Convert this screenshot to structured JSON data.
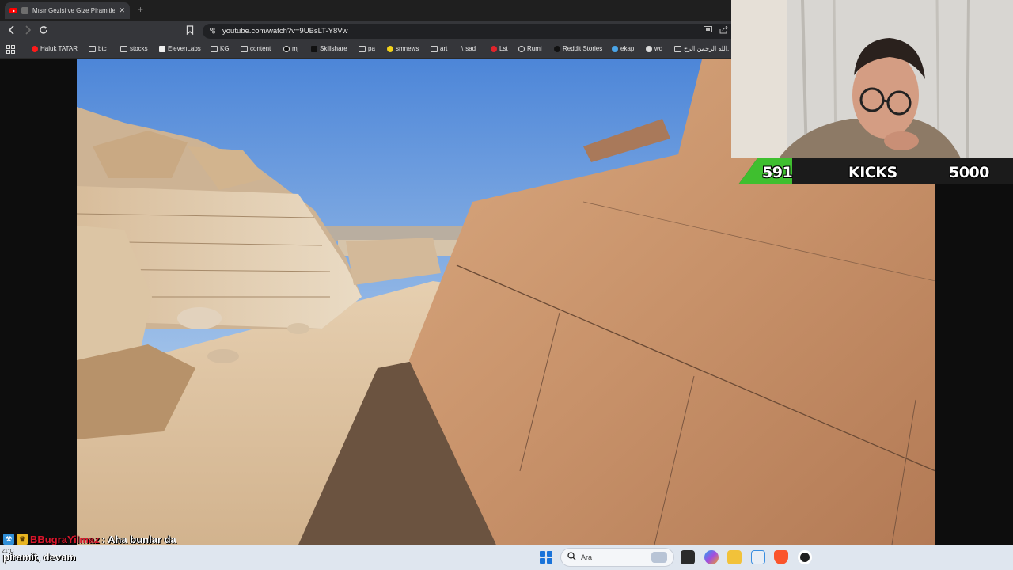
{
  "browser": {
    "tab_title": "Mısır Gezisi ve Gize Piramitler",
    "tab_close": "✕",
    "new_tab": "+",
    "url": "youtube.com/watch?v=9UBsLT-Y8Vw"
  },
  "bookmarks": [
    {
      "label": "Haluk TATAR",
      "icon": "youtube-icon"
    },
    {
      "label": "btc",
      "icon": "folder-icon"
    },
    {
      "label": "stocks",
      "icon": "folder-icon"
    },
    {
      "label": "ElevenLabs",
      "icon": "elevenlabs-icon"
    },
    {
      "label": "KG",
      "icon": "folder-icon"
    },
    {
      "label": "content",
      "icon": "folder-icon"
    },
    {
      "label": "mj",
      "icon": "github-icon"
    },
    {
      "label": "Skillshare",
      "icon": "skillshare-icon"
    },
    {
      "label": "pa",
      "icon": "folder-icon"
    },
    {
      "label": "smnews",
      "icon": "smiley-icon"
    },
    {
      "label": "art",
      "icon": "folder-icon"
    },
    {
      "label": "sad",
      "icon": "slash-icon"
    },
    {
      "label": "Lst",
      "icon": "s-icon"
    },
    {
      "label": "Rumi",
      "icon": "globe-icon"
    },
    {
      "label": "Reddit Stories",
      "icon": "d-icon"
    },
    {
      "label": "ekap",
      "icon": "bird-icon"
    },
    {
      "label": "wd",
      "icon": "globe-icon"
    },
    {
      "label": "الله الرحمن الرح...",
      "icon": "book-icon"
    }
  ],
  "overlay": {
    "count_left": "591",
    "label": "KICKS",
    "count_right": "5000"
  },
  "chat": {
    "user": "BBugraYilmaz",
    "message": ": Aha bunlar da",
    "continuation": "piramit, devam"
  },
  "taskbar": {
    "weather": "21°C",
    "search_placeholder": "Ara"
  },
  "colors": {
    "chrome_dark": "#1f1f1f",
    "toolbar": "#35363a",
    "kicks_green": "#3fbf2f",
    "chat_user_red": "#d9152b",
    "taskbar": "#dfe6ef"
  }
}
